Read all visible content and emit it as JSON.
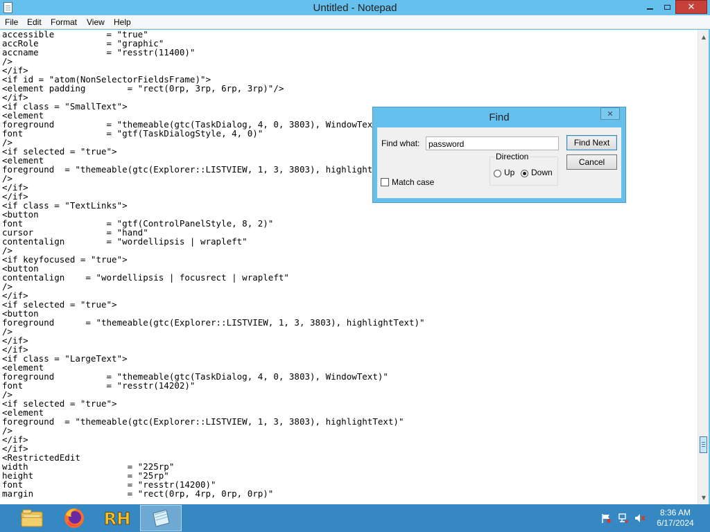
{
  "window": {
    "title": "Untitled - Notepad",
    "close_glyph": "✕"
  },
  "menu": {
    "items": [
      "File",
      "Edit",
      "Format",
      "View",
      "Help"
    ]
  },
  "editor": {
    "text": "accessible          = \"true\"\naccRole             = \"graphic\"\naccname             = \"resstr(11400)\"\n/>\n</if>\n<if id = \"atom(NonSelectorFieldsFrame)\">\n<element padding        = \"rect(0rp, 3rp, 6rp, 3rp)\"/>\n</if>\n<if class = \"SmallText\">\n<element\nforeground          = \"themeable(gtc(TaskDialog, 4, 0, 3803), WindowText)\"\nfont                = \"gtf(TaskDialogStyle, 4, 0)\"\n/>\n<if selected = \"true\">\n<element\nforeground  = \"themeable(gtc(Explorer::LISTVIEW, 1, 3, 3803), highlightText)\"\n/>\n</if>\n</if>\n<if class = \"TextLinks\">\n<button\nfont                = \"gtf(ControlPanelStyle, 8, 2)\"\ncursor              = \"hand\"\ncontentalign        = \"wordellipsis | wrapleft\"\n/>\n<if keyfocused = \"true\">\n<button\ncontentalign    = \"wordellipsis | focusrect | wrapleft\"\n/>\n</if>\n<if selected = \"true\">\n<button\nforeground      = \"themeable(gtc(Explorer::LISTVIEW, 1, 3, 3803), highlightText)\"\n/>\n</if>\n</if>\n<if class = \"LargeText\">\n<element\nforeground          = \"themeable(gtc(TaskDialog, 4, 0, 3803), WindowText)\"\nfont                = \"resstr(14202)\"\n/>\n<if selected = \"true\">\n<element\nforeground  = \"themeable(gtc(Explorer::LISTVIEW, 1, 3, 3803), highlightText)\"\n/>\n</if>\n</if>\n<RestrictedEdit\nwidth                   = \"225rp\"\nheight                  = \"25rp\"\nfont                    = \"resstr(14200)\"\nmargin                  = \"rect(0rp, 4rp, 0rp, 0rp)\""
  },
  "find_dialog": {
    "title": "Find",
    "find_what_label": "Find what:",
    "find_what_value": "password",
    "find_next_label": "Find Next",
    "cancel_label": "Cancel",
    "direction_label": "Direction",
    "up_label": "Up",
    "down_label": "Down",
    "direction_selected": "Down",
    "match_case_label": "Match case",
    "match_case_checked": false
  },
  "taskbar": {
    "pinned": [
      {
        "name": "File Explorer",
        "icon": "folder-icon"
      },
      {
        "name": "Firefox",
        "icon": "firefox-icon"
      },
      {
        "name": "Resource Hacker",
        "icon": "rh-icon",
        "text": "RH"
      },
      {
        "name": "Notepad",
        "icon": "notepad-icon",
        "active": true
      }
    ],
    "tray_icons": [
      "action-center-flag-icon",
      "network-icon",
      "volume-muted-icon"
    ],
    "time": "8:36 AM",
    "date": "6/17/2024"
  },
  "colors": {
    "title_bar": "#65c0ee",
    "close_button": "#c7403a",
    "taskbar": "#3588c2"
  }
}
